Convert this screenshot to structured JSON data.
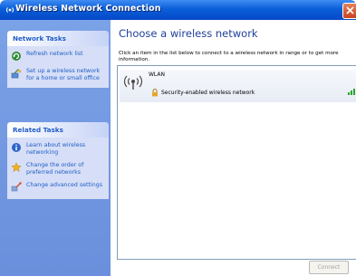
{
  "window": {
    "title": "Wireless Network Connection",
    "icons": [
      "wireless-network-icon",
      "close-icon"
    ]
  },
  "left_pane": {
    "network_tasks": {
      "header": "Network Tasks",
      "items": [
        {
          "label": "Refresh network list",
          "icon": "refresh-icon"
        },
        {
          "label": "Set up a wireless network for a home or small office",
          "icon": "setup-network-icon"
        }
      ]
    },
    "related_tasks": {
      "header": "Related Tasks",
      "items": [
        {
          "label": "Learn about wireless networking",
          "icon": "info-icon"
        },
        {
          "label": "Change the order of preferred networks",
          "icon": "star-icon"
        },
        {
          "label": "Change advanced settings",
          "icon": "settings-icon"
        }
      ]
    }
  },
  "main": {
    "heading": "Choose a wireless network",
    "instruction": "Click an item in the list below to connect to a wireless network in range or to get more information.",
    "networks": [
      {
        "ssid": "WLAN",
        "security": "Security-enabled wireless network",
        "icon": "antenna-icon",
        "lock_icon": "lock-icon",
        "signal_icon": "signal-strength-icon"
      }
    ],
    "connect_label": "Connect"
  },
  "colors": {
    "titlebar": "#0a5fd8",
    "left_pane": "#6a8fdc",
    "task_body": "#d6dff7",
    "task_link": "#215dc6",
    "heading": "#1e3f9a"
  }
}
